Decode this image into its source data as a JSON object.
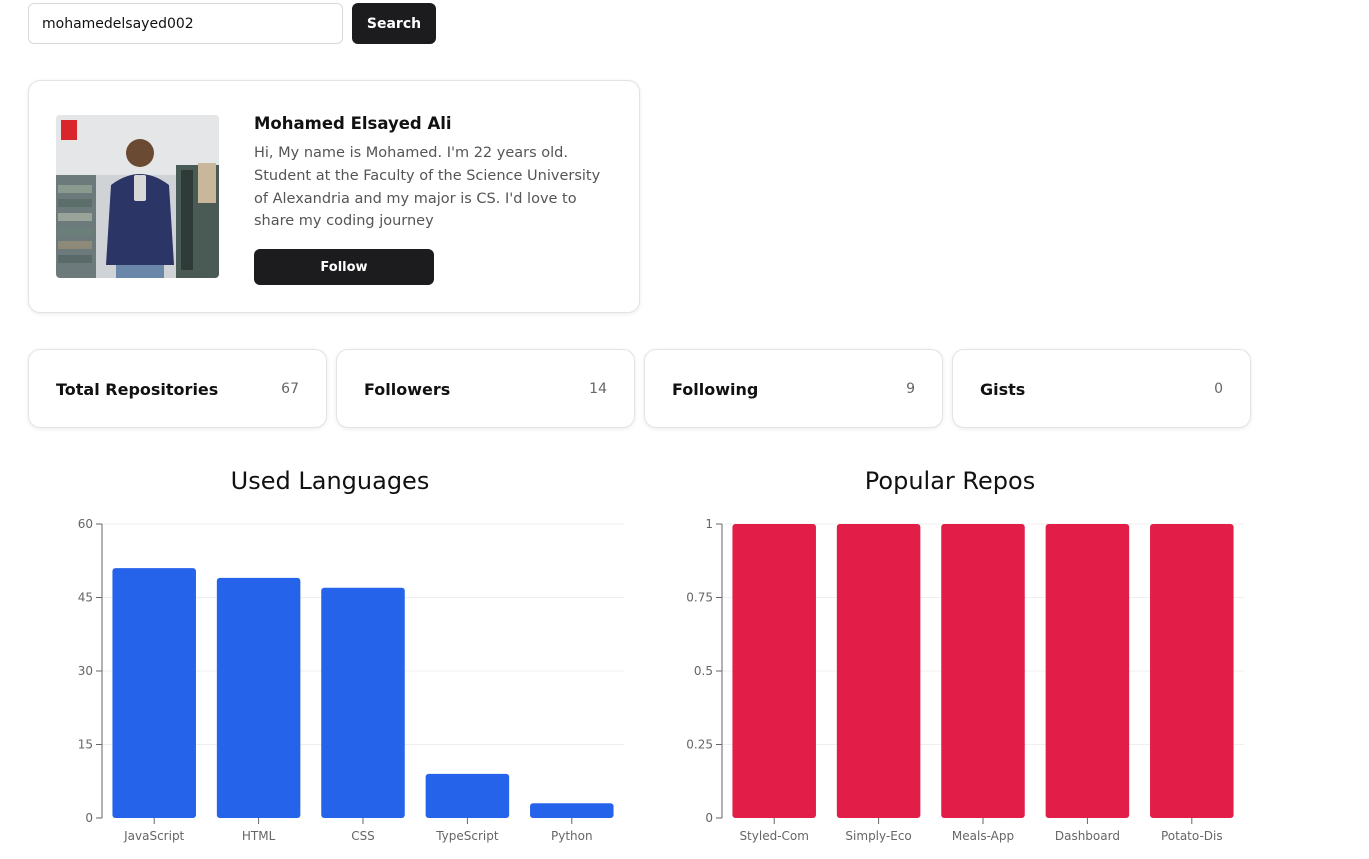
{
  "search": {
    "value": "mohamedelsayed002",
    "button_label": "Search"
  },
  "profile": {
    "name": "Mohamed Elsayed Ali",
    "bio": "Hi, My name is Mohamed. I'm 22 years old. Student at the Faculty of the Science University of Alexandria and my major is CS. I'd love to share my coding journey",
    "follow_label": "Follow",
    "avatar_icon": "user-photo"
  },
  "stats": [
    {
      "label": "Total Repositories",
      "value": "67"
    },
    {
      "label": "Followers",
      "value": "14"
    },
    {
      "label": "Following",
      "value": "9"
    },
    {
      "label": "Gists",
      "value": "0"
    }
  ],
  "chart_data": [
    {
      "type": "bar",
      "title": "Used Languages",
      "categories": [
        "JavaScript",
        "HTML",
        "CSS",
        "TypeScript",
        "Python"
      ],
      "values": [
        51,
        49,
        47,
        9,
        3
      ],
      "ylim": [
        0,
        60
      ],
      "yticks": [
        "0",
        "15",
        "30",
        "45",
        "60"
      ],
      "grid": true,
      "color": "#2563eb"
    },
    {
      "type": "bar",
      "title": "Popular Repos",
      "categories": [
        "Styled-Com",
        "Simply-Eco",
        "Meals-App",
        "Dashboard",
        "Potato-Dis"
      ],
      "values": [
        1,
        1,
        1,
        1,
        1
      ],
      "ylim": [
        0,
        1
      ],
      "yticks": [
        "0",
        "0.25",
        "0.5",
        "0.75",
        "1"
      ],
      "grid": true,
      "color": "#e11d48"
    }
  ]
}
